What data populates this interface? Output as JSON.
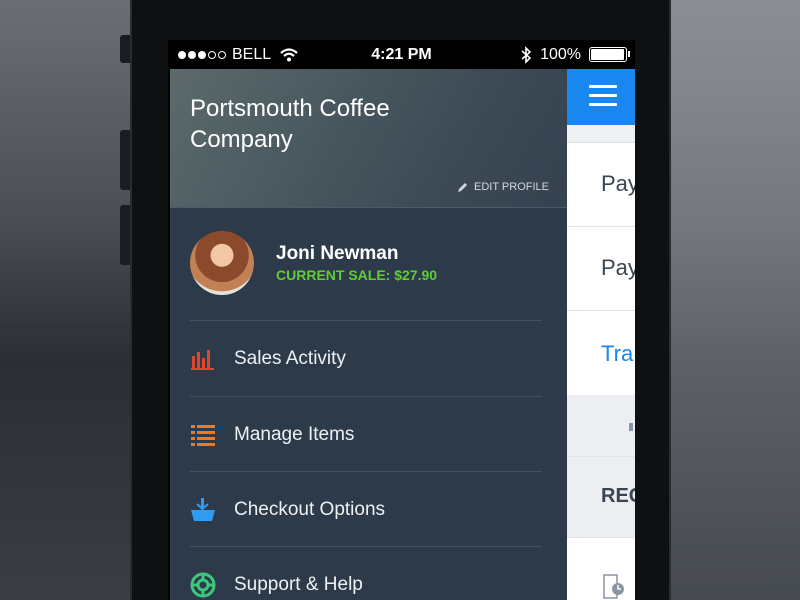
{
  "status_bar": {
    "carrier": "BELL",
    "time": "4:21 PM",
    "battery": "100%",
    "signal_icon": "signal-dots-icon",
    "wifi_icon": "wifi-icon",
    "bluetooth_icon": "bluetooth-icon"
  },
  "drawer": {
    "company_name": "Portsmouth Coffee Company",
    "edit_profile_label": "EDIT PROFILE",
    "user": {
      "name": "Joni Newman",
      "current_sale": "CURRENT SALE: $27.90"
    },
    "menu": [
      {
        "label": "Sales Activity",
        "icon": "bar-chart-icon",
        "color": "#e0452d"
      },
      {
        "label": "Manage Items",
        "icon": "list-icon",
        "color": "#f0781f"
      },
      {
        "label": "Checkout Options",
        "icon": "basket-icon",
        "color": "#2d9cf2"
      },
      {
        "label": "Support & Help",
        "icon": "lifebuoy-icon",
        "color": "#3cc77a"
      }
    ]
  },
  "panel": {
    "rows": [
      "Pay",
      "Pay",
      "Tra",
      "",
      "REC",
      ""
    ]
  },
  "colors": {
    "drawer_bg": "#2d3a4a",
    "accent_blue": "#1a86f0",
    "sale_green": "#5fce34"
  }
}
